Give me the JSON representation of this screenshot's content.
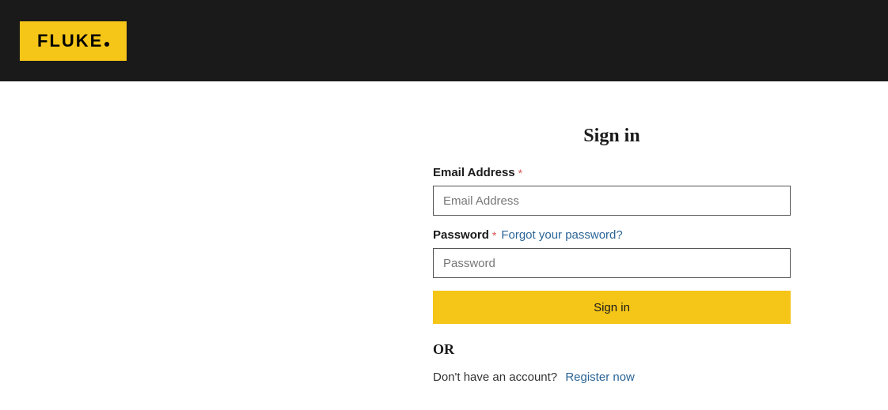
{
  "brand": {
    "name": "FLUKE",
    "accent_color": "#f5c518"
  },
  "signin": {
    "title": "Sign in",
    "email_label": "Email Address",
    "email_placeholder": "Email Address",
    "password_label": "Password",
    "password_placeholder": "Password",
    "forgot_link": "Forgot your password?",
    "submit_label": "Sign in",
    "or_label": "OR",
    "no_account_text": "Don't have an account?",
    "register_link": "Register now"
  }
}
